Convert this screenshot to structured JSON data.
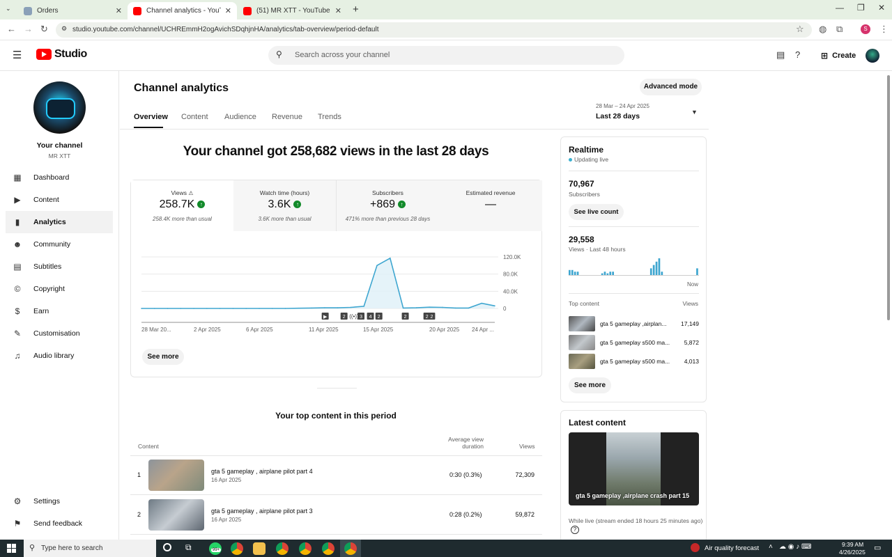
{
  "browser": {
    "tabs": [
      {
        "title": "Orders",
        "active": false
      },
      {
        "title": "Channel analytics - YouTube Studio",
        "active": true
      },
      {
        "title": "(51) MR XTT - YouTube",
        "active": false
      }
    ],
    "url": "studio.youtube.com/channel/UCHREmmH2ogAvichSDqhjnHA/analytics/tab-overview/period-default"
  },
  "header": {
    "logo_text": "Studio",
    "search_placeholder": "Search across your channel",
    "create_label": "Create"
  },
  "sidebar": {
    "channel_title": "Your channel",
    "channel_name": "MR XTT",
    "items": [
      {
        "label": "Dashboard",
        "icon": "dashboard-icon",
        "glyph": "▦"
      },
      {
        "label": "Content",
        "icon": "content-icon",
        "glyph": "▶"
      },
      {
        "label": "Analytics",
        "icon": "analytics-icon",
        "glyph": "▮"
      },
      {
        "label": "Community",
        "icon": "community-icon",
        "glyph": "☻"
      },
      {
        "label": "Subtitles",
        "icon": "subtitles-icon",
        "glyph": "▤"
      },
      {
        "label": "Copyright",
        "icon": "copyright-icon",
        "glyph": "©"
      },
      {
        "label": "Earn",
        "icon": "earn-icon",
        "glyph": "$"
      },
      {
        "label": "Customisation",
        "icon": "customisation-icon",
        "glyph": "✎"
      },
      {
        "label": "Audio library",
        "icon": "audio-library-icon",
        "glyph": "♫"
      }
    ],
    "settings_label": "Settings",
    "feedback_label": "Send feedback"
  },
  "main": {
    "title": "Channel analytics",
    "advanced_mode": "Advanced mode",
    "tabs": [
      "Overview",
      "Content",
      "Audience",
      "Revenue",
      "Trends"
    ],
    "date_range": "28 Mar – 24 Apr 2025",
    "date_label": "Last 28 days",
    "headline": "Your channel got 258,682 views in the last 28 days",
    "metrics": [
      {
        "label": "Views",
        "value": "258.7K",
        "note": "258.4K more than usual",
        "up": true
      },
      {
        "label": "Watch time (hours)",
        "value": "3.6K",
        "note": "3.6K more than usual",
        "up": true
      },
      {
        "label": "Subscribers",
        "value": "+869",
        "note": "471% more than previous 28 days",
        "up": true
      },
      {
        "label": "Estimated revenue",
        "value": "—",
        "note": "",
        "up": false
      }
    ],
    "see_more": "See more",
    "top_content_title": "Your top content in this period",
    "table_headers": {
      "content": "Content",
      "avd_line1": "Average view",
      "avd_line2": "duration",
      "views": "Views"
    },
    "top_content": [
      {
        "rank": "1",
        "title": "gta 5 gameplay , airplane pilot part 4",
        "date": "16 Apr 2025",
        "avd": "0:30 (0.3%)",
        "views": "72,309"
      },
      {
        "rank": "2",
        "title": "gta 5 gameplay , airplane pilot part 3",
        "date": "16 Apr 2025",
        "avd": "0:28 (0.2%)",
        "views": "59,872"
      }
    ]
  },
  "chart_data": {
    "type": "line",
    "x": [
      "28 Mar 2025",
      "29 Mar",
      "30 Mar",
      "31 Mar",
      "1 Apr",
      "2 Apr",
      "3 Apr",
      "4 Apr",
      "5 Apr",
      "6 Apr",
      "7 Apr",
      "8 Apr",
      "9 Apr",
      "10 Apr",
      "11 Apr",
      "12 Apr",
      "13 Apr",
      "14 Apr",
      "15 Apr",
      "16 Apr",
      "17 Apr",
      "18 Apr",
      "19 Apr",
      "20 Apr",
      "21 Apr",
      "22 Apr",
      "23 Apr",
      "24 Apr"
    ],
    "values": [
      0,
      0,
      0,
      0,
      0,
      0,
      0,
      0,
      0,
      0,
      0,
      0,
      500,
      1000,
      1500,
      1500,
      2500,
      5000,
      100000,
      117000,
      1000,
      1500,
      3000,
      2500,
      1000,
      1000,
      12000,
      6000
    ],
    "xtick_labels": [
      "28 Mar 20...",
      "2 Apr 2025",
      "6 Apr 2025",
      "11 Apr 2025",
      "15 Apr 2025",
      "20 Apr 2025",
      "24 Apr ..."
    ],
    "ytick_labels": [
      "120.0K",
      "80.0K",
      "40.0K",
      "0"
    ],
    "ylim": [
      0,
      120000
    ],
    "markers": [
      "▶",
      "2",
      "((•))",
      "3",
      "4",
      "2",
      "2",
      "2",
      "2"
    ],
    "series_color": "#3ea6d0"
  },
  "realtime": {
    "title": "Realtime",
    "live_label": "Updating live",
    "subscribers": "70,967",
    "subscribers_label": "Subscribers",
    "live_count_btn": "See live count",
    "views": "29,558",
    "views_label": "Views · Last 48 hours",
    "hourly_bars": [
      3,
      3,
      2,
      2,
      0,
      0,
      0,
      0,
      0,
      0,
      0,
      0,
      1,
      2,
      1,
      2,
      2,
      0,
      0,
      0,
      0,
      0,
      0,
      0,
      0,
      0,
      0,
      0,
      0,
      0,
      4,
      6,
      8,
      10,
      2,
      0,
      0,
      0,
      0,
      0,
      0,
      0,
      0,
      0,
      0,
      0,
      0,
      4
    ],
    "now_label": "Now",
    "top_content_label": "Top content",
    "views_col_label": "Views",
    "top_items": [
      {
        "title": "gta 5 gameplay ,airplan...",
        "views": "17,149"
      },
      {
        "title": "gta 5 gameplay s500 ma...",
        "views": "5,872"
      },
      {
        "title": "gta 5 gameplay s500 ma...",
        "views": "4,013"
      }
    ],
    "see_more": "See more"
  },
  "latest": {
    "title": "Latest content",
    "video_title": "gta 5 gameplay ,airplane crash part 15",
    "meta": "While live (stream ended 18 hours 25 minutes ago)"
  },
  "taskbar": {
    "search_text": "Type here to search",
    "air_quality": "Air quality forecast",
    "time": "9:39 AM",
    "date": "4/26/2025",
    "badge": "99+"
  }
}
